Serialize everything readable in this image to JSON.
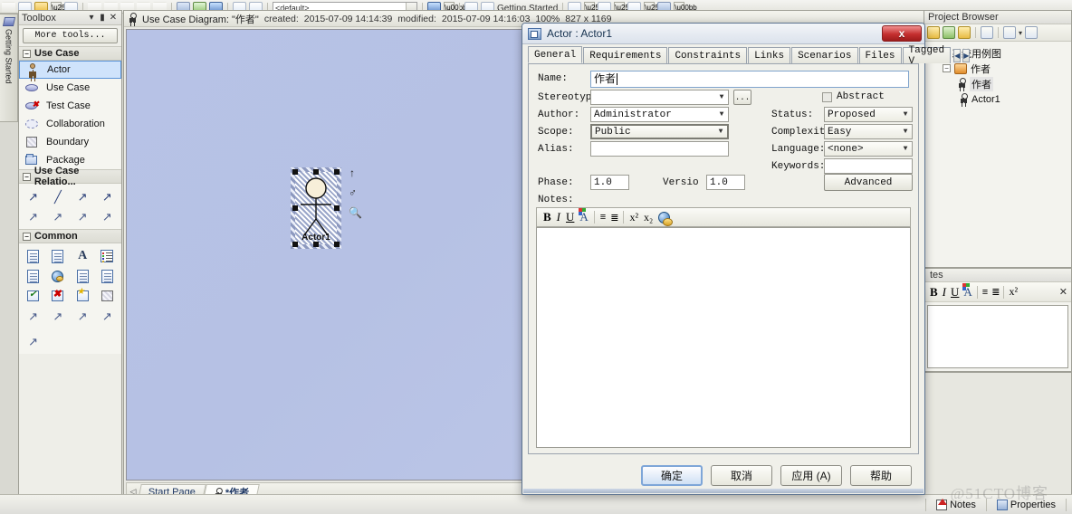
{
  "app": {
    "toolbar_combo_value": "<default>",
    "toolbar_right_label": "Getting Started"
  },
  "getting_started_tab": {
    "label": "Getting Started",
    "icon": "getting-started-icon"
  },
  "toolbox": {
    "title": "Toolbox",
    "window_buttons": [
      "▾",
      "▮",
      "✕"
    ],
    "more_tools_label": "More tools...",
    "groups": [
      {
        "name": "Use Case",
        "collapse_glyph": "−",
        "items": [
          {
            "label": "Actor",
            "icon": "actor-icon",
            "selected": true
          },
          {
            "label": "Use Case",
            "icon": "use-case-icon",
            "selected": false
          },
          {
            "label": "Test Case",
            "icon": "test-case-icon",
            "selected": false
          },
          {
            "label": "Collaboration",
            "icon": "collaboration-icon",
            "selected": false
          },
          {
            "label": "Boundary",
            "icon": "boundary-icon",
            "selected": false
          },
          {
            "label": "Package",
            "icon": "package-icon",
            "selected": false
          }
        ]
      },
      {
        "name": "Use Case Relatio...",
        "collapse_glyph": "−",
        "icons": [
          "association-icon",
          "generalize-icon",
          "include-icon",
          "extend-icon",
          "realize-icon",
          "dependency-icon",
          "trace-icon",
          "nesting-icon"
        ]
      },
      {
        "name": "Common",
        "collapse_glyph": "−",
        "icons": [
          "note-icon",
          "constraint-icon",
          "text-icon",
          "legend-icon",
          "document-artifact-icon",
          "web-resource-icon",
          "hyperlink-icon",
          "diagram-note-icon",
          "accept-event-icon",
          "reject-icon",
          "decision-icon",
          "boundary-shade-icon",
          "note-link-icon",
          "trace-link-icon",
          "dependency-link-icon",
          "realize-link-icon"
        ]
      }
    ]
  },
  "diagram": {
    "icon": "use-case-diagram-icon",
    "title": "Use Case Diagram: \"作者\"",
    "created_label": "created:",
    "created_value": "2015-07-09 14:14:39",
    "modified_label": "modified:",
    "modified_value": "2015-07-09 14:16:03",
    "zoom": "100%",
    "size": "827 x 1169",
    "element": {
      "name": "Actor1",
      "quick_icons": [
        "quick-link-arrow-icon",
        "actor-pin-icon",
        "zoom-icon"
      ]
    },
    "page_tabs": [
      {
        "label": "Start Page",
        "icon": null,
        "active": false
      },
      {
        "label": "*作者",
        "icon": "use-case-diagram-icon",
        "active": true
      }
    ],
    "scroll_arrow": "◁"
  },
  "project_browser": {
    "title": "Project Browser",
    "toolbar_icons": [
      "new-package-icon",
      "new-view-icon",
      "new-diagram-icon",
      "search-icon",
      "documentation-icon",
      "dropdown-arrow-icon",
      "properties-icon"
    ],
    "tree": [
      {
        "label": "系统用例图",
        "icon": "model-package-icon",
        "depth": 0,
        "expander": null,
        "selected": false
      },
      {
        "label": "作者",
        "icon": "package-icon",
        "depth": 1,
        "expander": "−",
        "selected": false
      },
      {
        "label": "作者",
        "icon": "use-case-diagram-icon",
        "depth": 2,
        "expander": null,
        "selected": true
      },
      {
        "label": "Actor1",
        "icon": "actor-icon",
        "depth": 2,
        "expander": null,
        "selected": false
      }
    ]
  },
  "notes_panel": {
    "title": "tes",
    "toolbar_icons": [
      "bold-icon",
      "italic-icon",
      "underline-icon",
      "font-color-icon",
      "bullet-list-icon",
      "numbered-list-icon",
      "superscript-icon",
      "subscript-icon",
      "close-icon"
    ]
  },
  "status_bar": {
    "items": [
      {
        "label": "Notes",
        "icon": "notes-icon"
      },
      {
        "label": "Properties",
        "icon": "properties-icon"
      }
    ]
  },
  "dialog": {
    "icon": "actor-properties-icon",
    "title": "Actor : Actor1",
    "close_label": "x",
    "tabs": [
      {
        "label": "General",
        "active": true
      },
      {
        "label": "Requirements",
        "active": false
      },
      {
        "label": "Constraints",
        "active": false
      },
      {
        "label": "Links",
        "active": false
      },
      {
        "label": "Scenarios",
        "active": false
      },
      {
        "label": "Files",
        "active": false
      },
      {
        "label": "Tagged V",
        "active": false
      }
    ],
    "tab_nav": {
      "prev": "◀",
      "next": "▶"
    },
    "fields": {
      "name_label": "Name:",
      "name_value": "作者",
      "stereotype_label": "Stereotyp",
      "stereotype_value": "",
      "stereotype_browse": "...",
      "author_label": "Author:",
      "author_value": "Administrator",
      "scope_label": "Scope:",
      "scope_value": "Public",
      "alias_label": "Alias:",
      "alias_value": "",
      "phase_label": "Phase:",
      "phase_value": "1.0",
      "version_label": "Versio",
      "version_value": "1.0",
      "notes_label": "Notes:",
      "abstract_label": "Abstract",
      "abstract_checked": false,
      "status_label": "Status:",
      "status_value": "Proposed",
      "complexity_label": "Complexit",
      "complexity_value": "Easy",
      "language_label": "Language:",
      "language_value": "<none>",
      "keywords_label": "Keywords:",
      "keywords_value": "",
      "advanced_label": "Advanced"
    },
    "notes_toolbar_icons": [
      "bold-icon",
      "italic-icon",
      "underline-icon",
      "font-color-icon",
      "bullet-list-icon",
      "numbered-list-icon",
      "superscript-icon",
      "subscript-icon",
      "hyperlink-icon"
    ],
    "notes_value": "",
    "buttons": [
      {
        "label": "确定",
        "default": true
      },
      {
        "label": "取消",
        "default": false
      },
      {
        "label": "应用 (A)",
        "default": false
      },
      {
        "label": "帮助",
        "default": false
      }
    ]
  },
  "watermark": "@51CTO博客"
}
